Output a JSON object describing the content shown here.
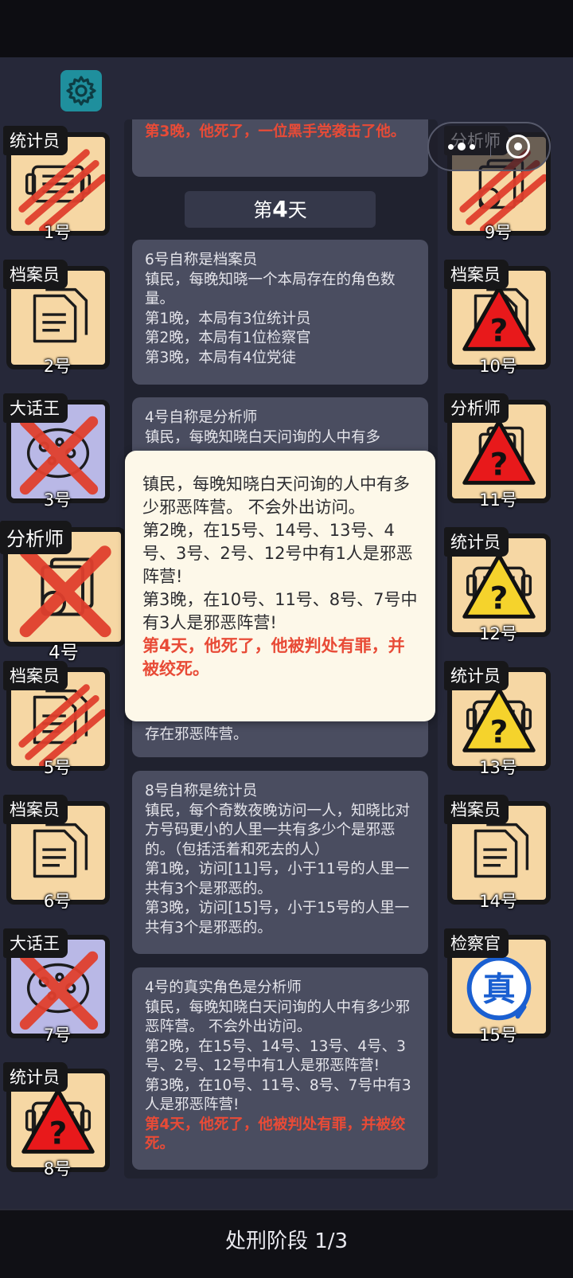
{
  "players_left": [
    {
      "num": "1号",
      "role": "统计员",
      "state": "clawed",
      "icon": "statistician",
      "bg": "orange"
    },
    {
      "num": "2号",
      "role": "档案员",
      "state": "normal",
      "icon": "archivist",
      "bg": "orange"
    },
    {
      "num": "3号",
      "role": "大话王",
      "state": "crossed",
      "icon": "boaster",
      "bg": "purple"
    },
    {
      "num": "4号",
      "role": "分析师",
      "state": "crossed",
      "icon": "analyst",
      "bg": "orange"
    },
    {
      "num": "5号",
      "role": "档案员",
      "state": "clawed",
      "icon": "archivist",
      "bg": "orange"
    },
    {
      "num": "6号",
      "role": "档案员",
      "state": "normal",
      "icon": "archivist",
      "bg": "orange"
    },
    {
      "num": "7号",
      "role": "大话王",
      "state": "crossed",
      "icon": "boaster",
      "bg": "purple"
    },
    {
      "num": "8号",
      "role": "统计员",
      "state": "suspect-red",
      "icon": "statistician",
      "bg": "orange"
    }
  ],
  "players_right": [
    {
      "num": "9号",
      "role": "分析师",
      "state": "clawed",
      "icon": "analyst",
      "bg": "orange"
    },
    {
      "num": "10号",
      "role": "档案员",
      "state": "suspect-red",
      "icon": "archivist",
      "bg": "orange"
    },
    {
      "num": "11号",
      "role": "分析师",
      "state": "suspect-red",
      "icon": "analyst",
      "bg": "orange"
    },
    {
      "num": "12号",
      "role": "统计员",
      "state": "suspect-yellow",
      "icon": "statistician",
      "bg": "orange"
    },
    {
      "num": "13号",
      "role": "统计员",
      "state": "suspect-yellow",
      "icon": "statistician",
      "bg": "orange"
    },
    {
      "num": "14号",
      "role": "档案员",
      "state": "normal",
      "icon": "archivist",
      "bg": "orange"
    },
    {
      "num": "15号",
      "role": "检察官",
      "state": "verified",
      "icon": "prosecutor",
      "bg": "orange",
      "stamp": "真"
    }
  ],
  "log": {
    "top_red": "第3晚，他死了，一位黑手党袭击了他。",
    "day_prefix": "第",
    "day_num": "4",
    "day_suffix": "天",
    "msg1": [
      "6号自称是档案员",
      "镇民，每晚知晓一个本局存在的角色数量。",
      "第1晚，本局有3位统计员",
      "第2晚，本局有1位检察官",
      "第3晚，本局有4位党徒"
    ],
    "msg2_visible": [
      "4号自称是分析师",
      "镇民，每晚知晓白天问询的人中有多"
    ],
    "msg2_tail": "存在邪恶阵营。",
    "msg3": [
      "8号自称是统计员",
      "镇民，每个奇数夜晚访问一人，知晓比对方号码更小的人里一共有多少个是邪恶的。（包括活着和死去的人）",
      "第1晚，访问[11]号，小于11号的人里一共有3个是邪恶的。",
      "第3晚，访问[15]号，小于15号的人里一共有3个是邪恶的。"
    ],
    "msg4": [
      "4号的真实角色是分析师",
      "镇民，每晚知晓白天问询的人中有多少邪恶阵营。 不会外出访问。",
      "第2晚，在15号、14号、13号、4号、3号、2号、12号中有1人是邪恶阵营!",
      "第3晚，在10号、11号、8号、7号中有3人是邪恶阵营!"
    ],
    "msg4_red": "第4天，他死了，他被判处有罪，并被绞死。"
  },
  "popup": {
    "lines": [
      "镇民，每晚知晓白天问询的人中有多少邪恶阵营。 不会外出访问。",
      "第2晚，在15号、14号、13号、4号、3号、2号、12号中有1人是邪恶阵营!",
      "第3晚，在10号、11号、8号、7号中有3人是邪恶阵营!"
    ],
    "red": "第4天，他死了，他被判处有罪，并被绞死。"
  },
  "phase": "处刑阶段 1/3",
  "colors": {
    "accent_teal": "#1f8f9d",
    "red_text": "#e84b37",
    "card_orange": "#f6d7a4",
    "card_purple": "#b9b8e6"
  }
}
